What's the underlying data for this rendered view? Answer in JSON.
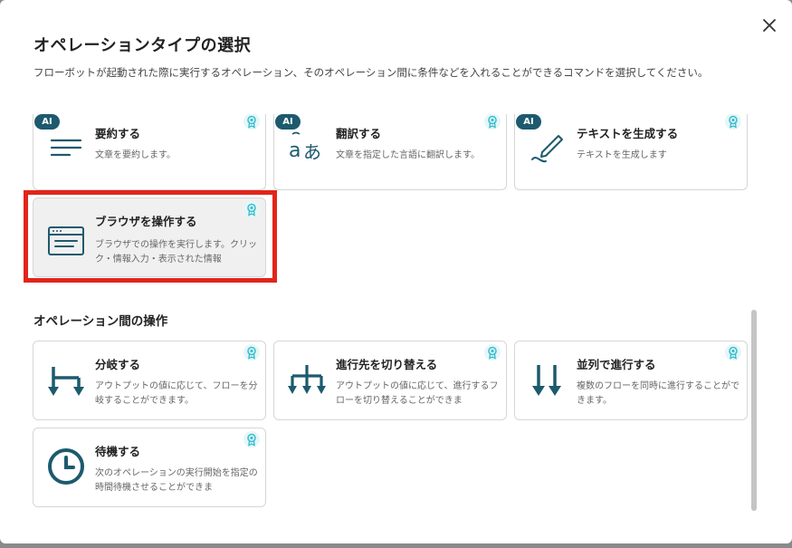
{
  "dialog": {
    "title": "オペレーションタイプの選択",
    "description": "フローボットが起動された際に実行するオペレーション、そのオペレーション間に条件などを入れることができるコマンドを選択してください。"
  },
  "ai_tag": "AI",
  "cards_ai": [
    {
      "title": "要約する",
      "desc": "文章を要約します。",
      "icon": "summary-lines-icon"
    },
    {
      "title": "翻訳する",
      "desc": "文章を指定した言語に翻訳します。",
      "icon": "translate-icon"
    },
    {
      "title": "テキストを生成する",
      "desc": "テキストを生成します",
      "icon": "pen-write-icon"
    }
  ],
  "browser_card": {
    "title": "ブラウザを操作する",
    "desc": "ブラウザでの操作を実行します。クリック・情報入力・表示された情報",
    "icon": "browser-window-icon"
  },
  "section": {
    "title": "オペレーション間の操作"
  },
  "cards_ops": [
    {
      "title": "分岐する",
      "desc": "アウトプットの値に応じて、フローを分岐することができます。",
      "icon": "branch-icon"
    },
    {
      "title": "進行先を切り替える",
      "desc": "アウトプットの値に応じて、進行するフローを切り替えることができま",
      "icon": "switch-path-icon"
    },
    {
      "title": "並列で進行する",
      "desc": "複数のフローを同時に進行することができます。",
      "icon": "parallel-arrows-icon"
    },
    {
      "title": "待機する",
      "desc": "次のオペレーションの実行開始を指定の時間待機させることができま",
      "icon": "clock-icon"
    }
  ],
  "colors": {
    "icon": "#1d5a6e",
    "badge": "#3bbfcf",
    "highlight": "#e1251b"
  }
}
